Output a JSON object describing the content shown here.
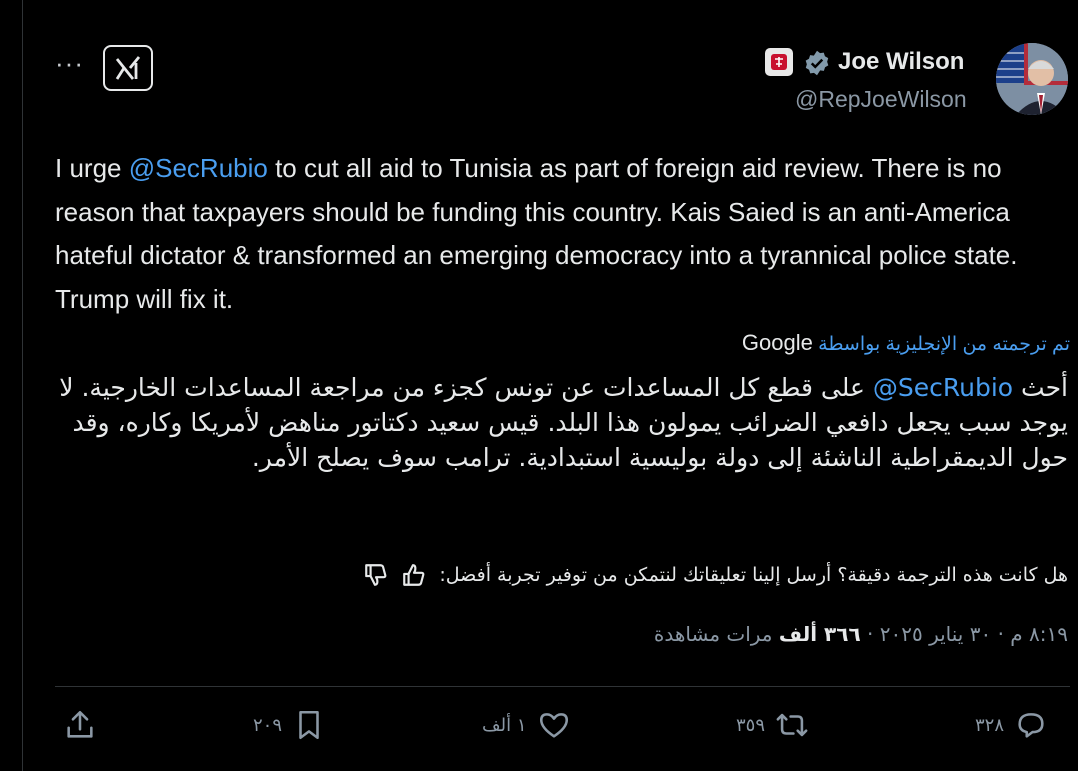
{
  "author": {
    "display_name": "Joe Wilson",
    "handle": "@RepJoeWilson"
  },
  "tweet": {
    "text_before_mention": "I urge ",
    "mention": "@SecRubio",
    "text_after_mention": " to cut all aid to Tunisia as part of foreign aid review. There is no reason that taxpayers should be funding this country. Kais Saied is an anti-America hateful dictator & transformed an emerging democracy into a tyrannical police state. Trump will fix it."
  },
  "translation": {
    "label": "تم ترجمته من الإنجليزية بواسطة",
    "provider": "Google",
    "text_before_mention": "أحث ",
    "mention": "@SecRubio",
    "text_after_mention": " على قطع كل المساعدات عن تونس كجزء من مراجعة المساعدات الخارجية. لا يوجد سبب يجعل دافعي الضرائب يمولون هذا البلد. قيس سعيد دكتاتور مناهض لأمريكا وكاره، وقد حول الديمقراطية الناشئة إلى دولة بوليسية استبدادية. ترامب سوف يصلح الأمر.",
    "feedback_prompt": "هل كانت هذه الترجمة دقيقة؟ أرسل إلينا تعليقاتك لنتمكن من توفير تجربة أفضل:"
  },
  "meta": {
    "time_date": "٨:١٩ م · ٣٠ يناير ٢٠٢٥ · ",
    "views_count": "٣٦٦ ألف",
    "views_label": " مرات مشاهدة"
  },
  "actions": {
    "replies": "٣٢٨",
    "reposts": "٣٥٩",
    "likes": "١ ألف",
    "bookmarks": "٢٠٩"
  },
  "colors": {
    "background": "#000000",
    "text": "#e7e9ea",
    "secondary": "#8b98a5",
    "link": "#4a9ef0",
    "verified": "#829aab"
  }
}
